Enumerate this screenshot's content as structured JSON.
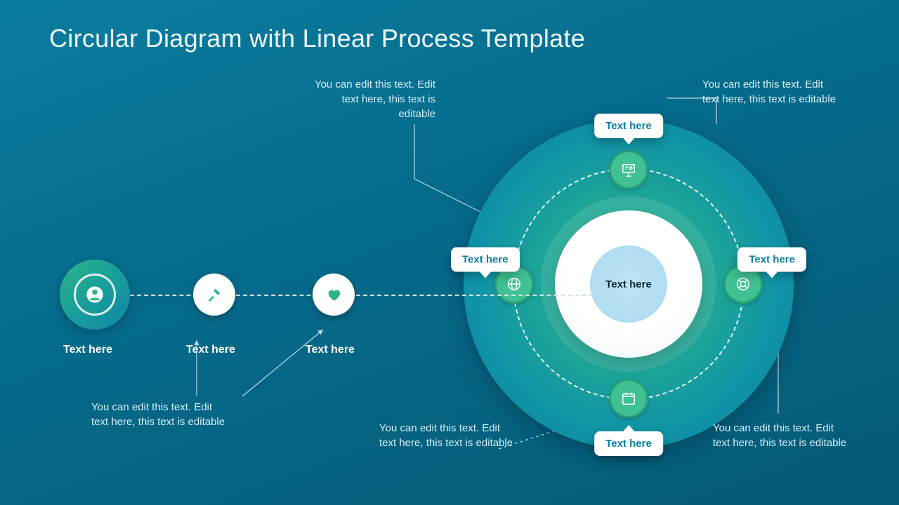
{
  "title": "Circular Diagram with Linear Process Template",
  "linear": {
    "steps": [
      {
        "label": "Text here"
      },
      {
        "label": "Text here"
      },
      {
        "label": "Text here"
      }
    ]
  },
  "circle": {
    "center": "Text here",
    "nodes": {
      "top": "Text here",
      "right": "Text here",
      "bottom": "Text here",
      "left": "Text here"
    }
  },
  "callouts": {
    "top_left": "You can edit this text. Edit text here, this text is editable",
    "top_right": "You can edit this text. Edit text here, this text is editable",
    "bottom_left": "You can edit this text. Edit text here, this text is editable",
    "bottom_mid": "You can edit this text. Edit text here, this text is editable",
    "bottom_right": "You can edit this text. Edit text here, this text is editable"
  },
  "colors": {
    "accent_green": "#3fc193",
    "accent_teal": "#0a7da0",
    "pill_text": "#0a7da0"
  }
}
